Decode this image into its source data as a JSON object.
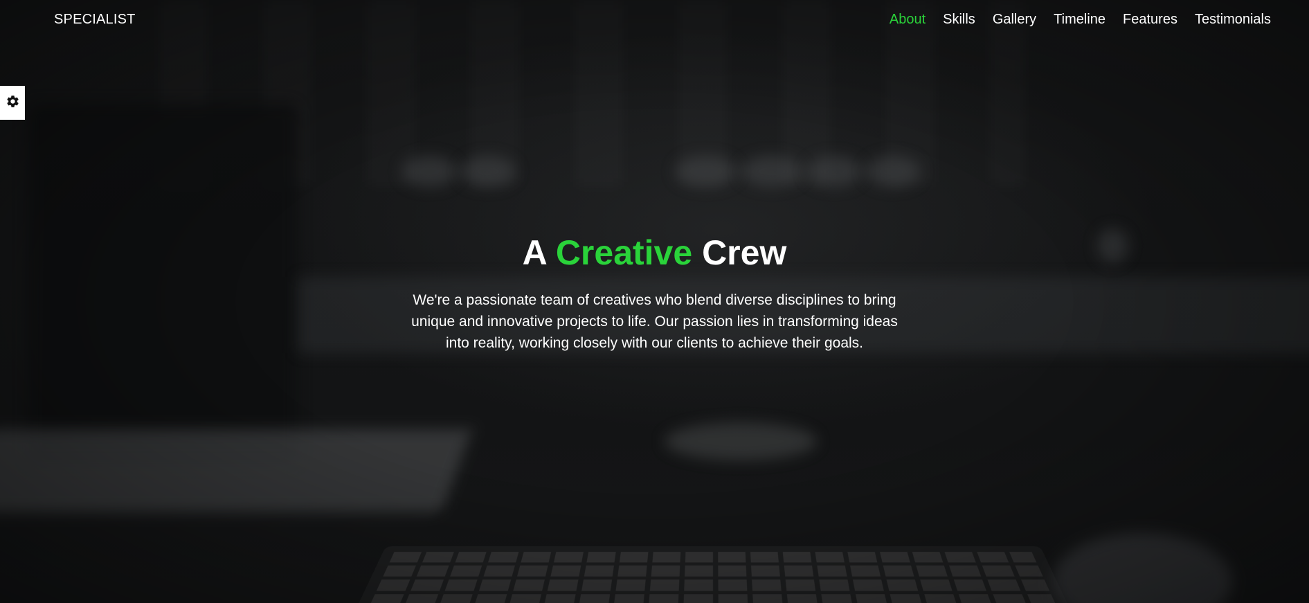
{
  "brand": {
    "label": "SPECIALIST"
  },
  "nav": {
    "items": [
      {
        "label": "About",
        "active": true
      },
      {
        "label": "Skills",
        "active": false
      },
      {
        "label": "Gallery",
        "active": false
      },
      {
        "label": "Timeline",
        "active": false
      },
      {
        "label": "Features",
        "active": false
      },
      {
        "label": "Testimonials",
        "active": false
      }
    ]
  },
  "settings": {
    "icon": "gear-icon"
  },
  "hero": {
    "title_prefix": "A",
    "title_highlight": "Creative",
    "title_suffix": "Crew",
    "description": "We're a passionate team of creatives who blend diverse disciplines to bring unique and innovative projects to life. Our passion lies in transforming ideas into reality, working closely with our clients to achieve their goals."
  },
  "colors": {
    "accent": "#2ad33a",
    "text": "#ffffff",
    "background": "#121314"
  }
}
